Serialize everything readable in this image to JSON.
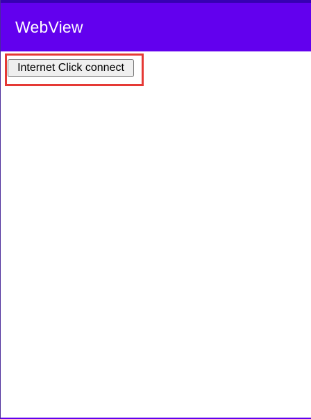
{
  "colors": {
    "status_bar": "#3700B3",
    "app_bar": "#6200EE",
    "bottom_edge": "#6200EE",
    "highlight": "#E53935"
  },
  "app_bar": {
    "title": "WebView"
  },
  "webview": {
    "button_label": "Internet Click connect"
  }
}
